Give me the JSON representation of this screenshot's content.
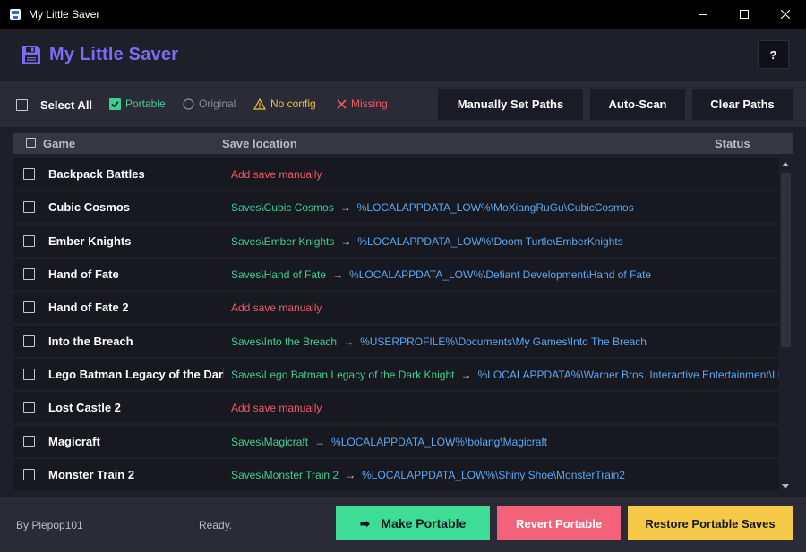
{
  "window": {
    "title": "My Little Saver"
  },
  "header": {
    "title": "My Little Saver",
    "help_label": "?"
  },
  "toolbar": {
    "select_all_label": "Select All",
    "legend": {
      "portable": "Portable",
      "original": "Original",
      "no_config": "No config",
      "missing": "Missing"
    },
    "manually_set_paths_label": "Manually Set Paths",
    "auto_scan_label": "Auto-Scan",
    "clear_paths_label": "Clear Paths"
  },
  "columns": {
    "game": "Game",
    "save_location": "Save location",
    "status": "Status"
  },
  "rows": [
    {
      "game": "Backpack Battles",
      "add_label": "Add save manually"
    },
    {
      "game": "Cubic Cosmos",
      "source": "Saves\\Cubic Cosmos",
      "arrow": "→",
      "target": "%LOCALAPPDATA_LOW%\\MoXiangRuGu\\CubicCosmos"
    },
    {
      "game": "Ember Knights",
      "source": "Saves\\Ember Knights",
      "arrow": "→",
      "target": "%LOCALAPPDATA_LOW%\\Doom Turtle\\EmberKnights"
    },
    {
      "game": "Hand of Fate",
      "source": "Saves\\Hand of Fate",
      "arrow": "→",
      "target": "%LOCALAPPDATA_LOW%\\Defiant Development\\Hand of Fate"
    },
    {
      "game": "Hand of Fate 2",
      "add_label": "Add save manually"
    },
    {
      "game": "Into the Breach",
      "source": "Saves\\Into the Breach",
      "arrow": "→",
      "target": "%USERPROFILE%\\Documents\\My Games\\Into The Breach"
    },
    {
      "game": "Lego Batman Legacy of the Dark Knight",
      "source": "Saves\\Lego Batman Legacy of the Dark Knight",
      "arrow": "→",
      "target": "%LOCALAPPDATA%\\Warner Bros. Interactive Entertainment\\LEGO"
    },
    {
      "game": "Lost Castle 2",
      "add_label": "Add save manually"
    },
    {
      "game": "Magicraft",
      "source": "Saves\\Magicraft",
      "arrow": "→",
      "target": "%LOCALAPPDATA_LOW%\\bolang\\Magicraft"
    },
    {
      "game": "Monster Train 2",
      "source": "Saves\\Monster Train 2",
      "arrow": "→",
      "target": "%LOCALAPPDATA_LOW%\\Shiny Shoe\\MonsterTrain2"
    }
  ],
  "footer": {
    "by_label": "By Piepop101",
    "status_text": "Ready.",
    "make_portable_label": "Make Portable",
    "make_portable_icon": "➡",
    "revert_portable_label": "Revert Portable",
    "restore_label": "Restore Portable Saves"
  },
  "colors": {
    "accent": "#7b6cf6",
    "portable": "#3ecf8e",
    "path": "#5aa9f0",
    "missing": "#f05a66",
    "warning": "#f0c040",
    "make_portable_bg": "#3ddc97",
    "revert_bg": "#f2637a",
    "restore_bg": "#f7c948"
  }
}
